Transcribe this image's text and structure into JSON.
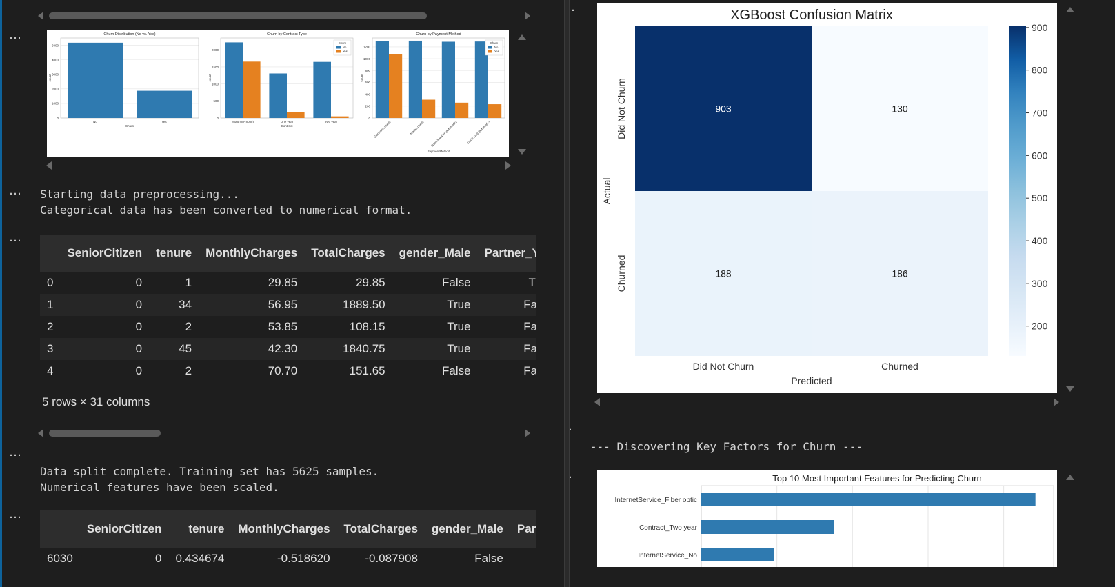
{
  "left": {
    "output_label": "…",
    "fig1": {
      "panels": [
        {
          "title": "Churn Distribution (No vs. Yes)",
          "xlabel": "Churn",
          "ylabel": "count",
          "categories": [
            "No",
            "Yes"
          ],
          "yticks": [
            "0",
            "1000",
            "2000",
            "3000",
            "4000",
            "5000"
          ],
          "values": [
            5174,
            1869
          ],
          "ymax": 5500
        },
        {
          "title": "Churn by Contract Type",
          "xlabel": "Contract",
          "ylabel": "count",
          "categories": [
            "Month-to-month",
            "One year",
            "Two year"
          ],
          "yticks": [
            "0",
            "500",
            "1000",
            "1500",
            "2000"
          ],
          "series_no": [
            2220,
            1307,
            1647
          ],
          "series_yes": [
            1655,
            166,
            48
          ],
          "ymax": 2350,
          "legend_title": "Churn",
          "legend": [
            "No",
            "Yes"
          ]
        },
        {
          "title": "Churn by Payment Method",
          "xlabel": "PaymentMethod",
          "ylabel": "count",
          "categories": [
            "Electronic check",
            "Mailed check",
            "Bank transfer (automatic)",
            "Credit card (automatic)"
          ],
          "yticks": [
            "0",
            "200",
            "400",
            "600",
            "800",
            "1000",
            "1200"
          ],
          "series_no": [
            1294,
            1304,
            1286,
            1290
          ],
          "series_yes": [
            1071,
            308,
            258,
            232
          ],
          "ymax": 1350,
          "legend_title": "Churn",
          "legend": [
            "No",
            "Yes"
          ]
        }
      ],
      "colors": {
        "no": "#2f7ab0",
        "yes": "#e58120"
      }
    },
    "preprocess_text": "Starting data preprocessing...\nCategorical data has been converted to numerical format.",
    "table1": {
      "columns": [
        "",
        "SeniorCitizen",
        "tenure",
        "MonthlyCharges",
        "TotalCharges",
        "gender_Male",
        "Partner_Yes"
      ],
      "rows": [
        [
          "0",
          "0",
          "1",
          "29.85",
          "29.85",
          "False",
          "True"
        ],
        [
          "1",
          "0",
          "34",
          "56.95",
          "1889.50",
          "True",
          "False"
        ],
        [
          "2",
          "0",
          "2",
          "53.85",
          "108.15",
          "True",
          "False"
        ],
        [
          "3",
          "0",
          "45",
          "42.30",
          "1840.75",
          "True",
          "False"
        ],
        [
          "4",
          "0",
          "2",
          "70.70",
          "151.65",
          "False",
          "False"
        ]
      ],
      "caption": "5 rows × 31 columns"
    },
    "split_text": "Data split complete. Training set has 5625 samples.\nNumerical features have been scaled.",
    "table2": {
      "columns": [
        "",
        "SeniorCitizen",
        "tenure",
        "MonthlyCharges",
        "TotalCharges",
        "gender_Male",
        "Partner"
      ],
      "rows": [
        [
          "6030",
          "0",
          "0.434674",
          "-0.518620",
          "-0.087908",
          "False",
          ""
        ]
      ]
    }
  },
  "right": {
    "output_label": "…",
    "chart_data": [
      {
        "type": "heatmap",
        "title": "XGBoost Confusion Matrix",
        "xlabel": "Predicted",
        "ylabel": "Actual",
        "x_categories": [
          "Did Not Churn",
          "Churned"
        ],
        "y_categories": [
          "Did Not Churn",
          "Churned"
        ],
        "values": [
          [
            903,
            130
          ],
          [
            188,
            186
          ]
        ],
        "colorbar_ticks": [
          "900",
          "800",
          "700",
          "600",
          "500",
          "400",
          "300",
          "200"
        ],
        "colorbar_range": [
          130,
          903
        ],
        "colormap": "Blues"
      },
      {
        "type": "bar",
        "orientation": "horizontal",
        "title": "Top 10 Most Important Features for Predicting Churn",
        "categories": [
          "InternetService_Fiber optic",
          "Contract_Two year",
          "InternetService_No"
        ],
        "values": [
          0.442,
          0.176,
          0.096
        ],
        "color": "#2f7ab0"
      }
    ],
    "factors_text": "--- Discovering Key Factors for Churn ---"
  }
}
